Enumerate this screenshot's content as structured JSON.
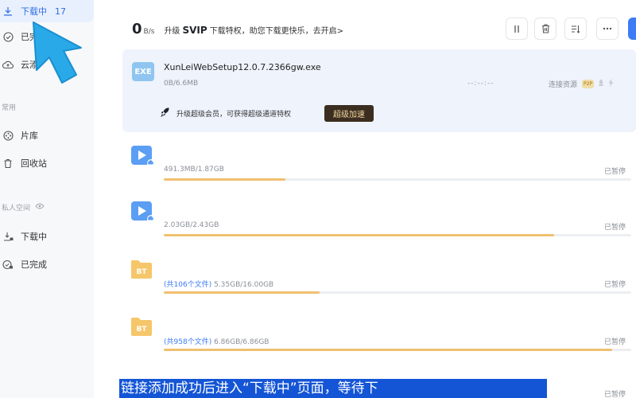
{
  "sidebar": {
    "downloading": {
      "label": "下载中",
      "count": "17"
    },
    "completed": {
      "label": "已完"
    },
    "cloud": {
      "label": "云添"
    },
    "common_section": "常用",
    "library": "片库",
    "recycle": "回收站",
    "private_section": "私人空间",
    "private_downloading": "下载中",
    "private_completed": "已完成"
  },
  "header": {
    "speed_value": "0",
    "speed_unit": "B/s",
    "promo_prefix": "升级",
    "promo_svip": "SVIP",
    "promo_suffix": "下载特权，助您下载更快乐，去开启>"
  },
  "active_task": {
    "icon_text": "EXE",
    "filename": "XunLeiWebSetup12.0.7.2366gw.exe",
    "size": "0B/6.6MB",
    "time": "--:--:--",
    "source_label": "连接资源",
    "badge": "P2P",
    "promo": "升级超级会员，可获得超级通道特权",
    "boost_label": "超级加速"
  },
  "tasks": [
    {
      "type": "video",
      "files": "",
      "size": "491.3MB/1.87GB",
      "status": "已暂停",
      "progress": 0.26
    },
    {
      "type": "video",
      "files": "",
      "size": "2.03GB/2.43GB",
      "status": "已暂停",
      "progress": 0.835
    },
    {
      "type": "bt",
      "files": "(共106个文件)",
      "size": "5.35GB/16.00GB",
      "status": "已暂停",
      "progress": 0.334
    },
    {
      "type": "bt",
      "files": "(共958个文件)",
      "size": "6.86GB/6.86GB",
      "status": "已暂停",
      "progress": 0.96
    }
  ],
  "bt_icon_text": "BT",
  "last_status": "已暂停",
  "caption": "链接添加成功后进入“下载中”页面，等待下",
  "colors": {
    "accent": "#3d7bf7",
    "progress": "#f0c070",
    "caption_bg": "#1455d6",
    "pointer": "#29a9e8"
  }
}
